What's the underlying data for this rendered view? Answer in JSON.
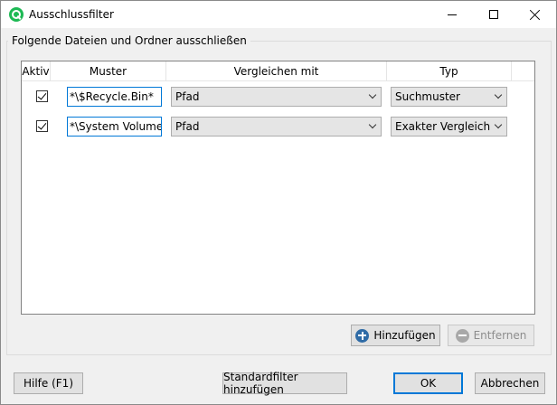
{
  "window": {
    "title": "Ausschlussfilter"
  },
  "group": {
    "label": "Folgende Dateien und Ordner ausschließen"
  },
  "table": {
    "columns": [
      "Aktiv",
      "Muster",
      "Vergleichen mit",
      "Typ"
    ],
    "rows": [
      {
        "active": true,
        "pattern": "*\\$Recycle.Bin*",
        "compare_with": "Pfad",
        "type": "Suchmuster"
      },
      {
        "active": true,
        "pattern": "*\\System Volume In",
        "compare_with": "Pfad",
        "type": "Exakter Vergleich"
      }
    ]
  },
  "buttons": {
    "add": "Hinzufügen",
    "remove": "Entfernen",
    "help": "Hilfe (F1)",
    "standard_filter": "Standardfilter hinzufügen",
    "ok": "OK",
    "cancel": "Abbrechen"
  },
  "colors": {
    "accent": "#0078d7",
    "app_icon": "#1db954",
    "add_icon": "#2f6ba6"
  }
}
